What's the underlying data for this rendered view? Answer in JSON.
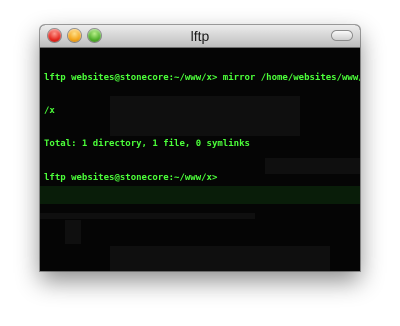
{
  "window": {
    "title": "lftp"
  },
  "terminal": {
    "lines": [
      "lftp websites@stonecore:~/www/x> mirror /home/websites/www/x .",
      "/x",
      "Total: 1 directory, 1 file, 0 symlinks",
      "lftp websites@stonecore:~/www/x>"
    ],
    "text_color": "#4cff3a",
    "background_color": "#050505"
  },
  "icons": {
    "close": "close-icon",
    "minimize": "minimize-icon",
    "zoom": "zoom-icon",
    "toolbar_toggle": "toolbar-toggle-icon"
  }
}
